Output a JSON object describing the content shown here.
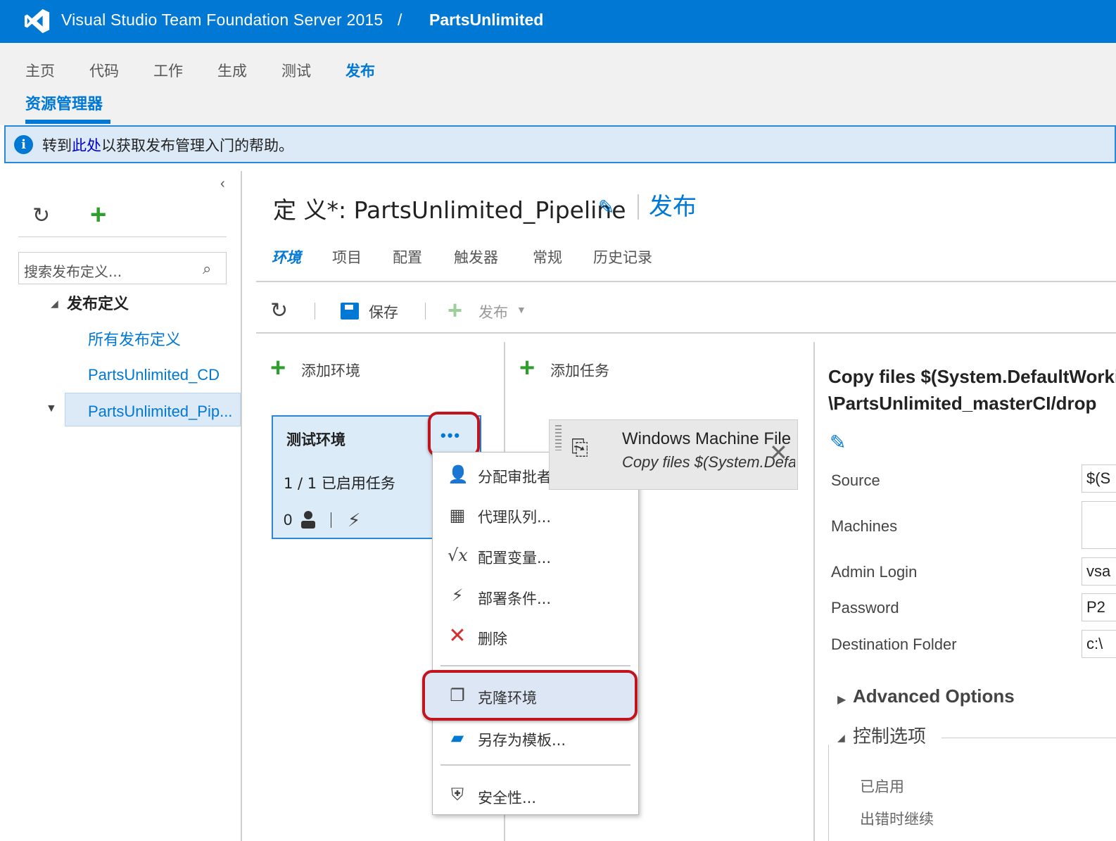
{
  "header": {
    "product_title": "Visual Studio Team Foundation Server 2015",
    "separator": "/",
    "project": "PartsUnlimited"
  },
  "nav": {
    "items": [
      {
        "label": "主页"
      },
      {
        "label": "代码"
      },
      {
        "label": "工作"
      },
      {
        "label": "生成"
      },
      {
        "label": "测试"
      },
      {
        "label": "发布",
        "active": true
      }
    ],
    "sub": "资源管理器"
  },
  "info": {
    "prefix": "转到",
    "link": "此处",
    "suffix": "以获取发布管理入门的帮助。"
  },
  "left": {
    "search_placeholder": "搜索发布定义...",
    "tree_root": "发布定义",
    "items": [
      "所有发布定义",
      "PartsUnlimited_CD",
      "PartsUnlimited_Pip..."
    ]
  },
  "definition": {
    "title": "定 义*: PartsUnlimited_Pipeline",
    "release_link": "发布",
    "tabs": [
      "环境",
      "项目",
      "配置",
      "触发器",
      "常规",
      "历史记录"
    ],
    "toolbar": {
      "save": "保存",
      "release": "发布"
    }
  },
  "environments": {
    "add_label": "添加环境",
    "card": {
      "name": "测试环境",
      "tasks": "1 / 1 已启用任务",
      "approvers": "0"
    },
    "menu": [
      "分配审批者...",
      "代理队列...",
      "配置变量...",
      "部署条件...",
      "删除",
      "克隆环境",
      "另存为模板...",
      "安全性..."
    ]
  },
  "tasks": {
    "add_label": "添加任务",
    "card": {
      "name": "Windows Machine File Copy",
      "subtitle": "Copy files $(System.DefaultWorkingDirectory)"
    }
  },
  "details": {
    "title_line1": "Copy files $(System.DefaultWorkingDirectory)",
    "title_line2": "\\PartsUnlimited_masterCI/drop",
    "fields": [
      {
        "label": "Source",
        "value": "$(S"
      },
      {
        "label": "Machines",
        "value": ""
      },
      {
        "label": "Admin Login",
        "value": "vsa"
      },
      {
        "label": "Password",
        "value": "P2"
      },
      {
        "label": "Destination Folder",
        "value": "c:\\"
      }
    ],
    "advanced": "Advanced Options",
    "control": "控制选项",
    "control_items": [
      "已启用",
      "出错时继续"
    ]
  },
  "colors": {
    "brand": "#0078d4",
    "highlight": "#c0141f",
    "add": "#2e9e2e"
  }
}
